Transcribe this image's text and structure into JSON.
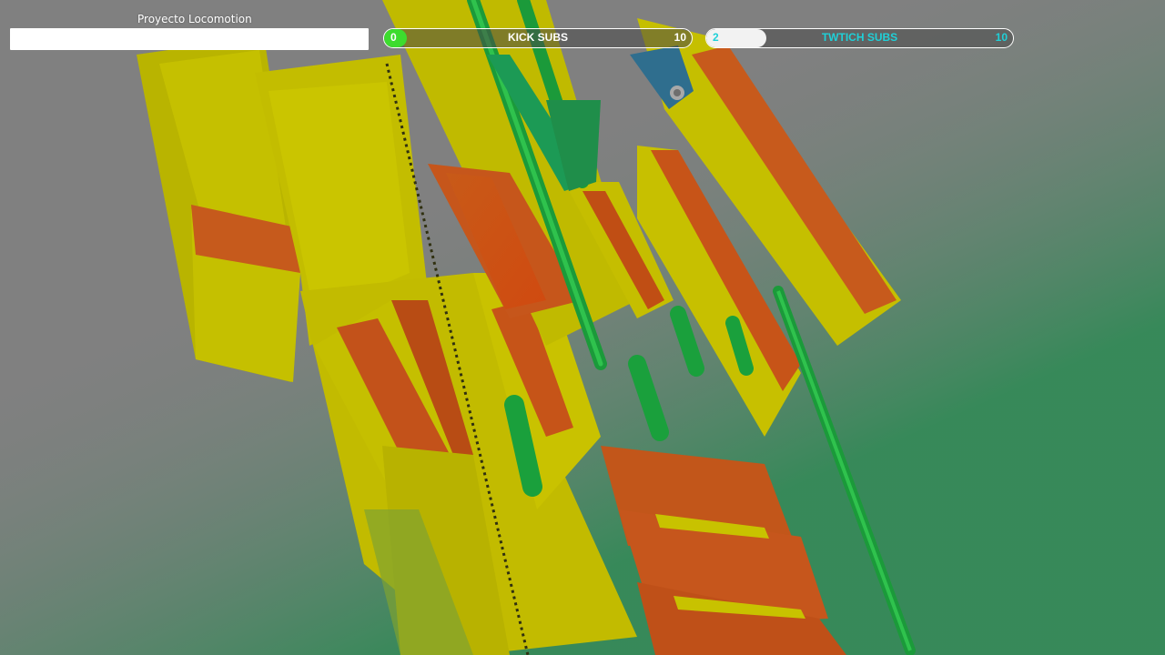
{
  "overlay": {
    "title": "Proyecto Locomotion"
  },
  "kick_subs": {
    "label": "KICK SUBS",
    "current": "0",
    "goal": "10",
    "progress_fraction": 0.0,
    "fill_color": "#3ddc2e"
  },
  "twitch_subs": {
    "label": "TWTICH SUBS",
    "current": "2",
    "goal": "10",
    "progress_fraction": 0.2,
    "text_color": "#1fd0d8"
  },
  "scene": {
    "description_colors": {
      "background": "#808080",
      "part_yellow": "#c8c800",
      "part_red": "#c84a10",
      "part_green": "#1fa83c"
    }
  }
}
